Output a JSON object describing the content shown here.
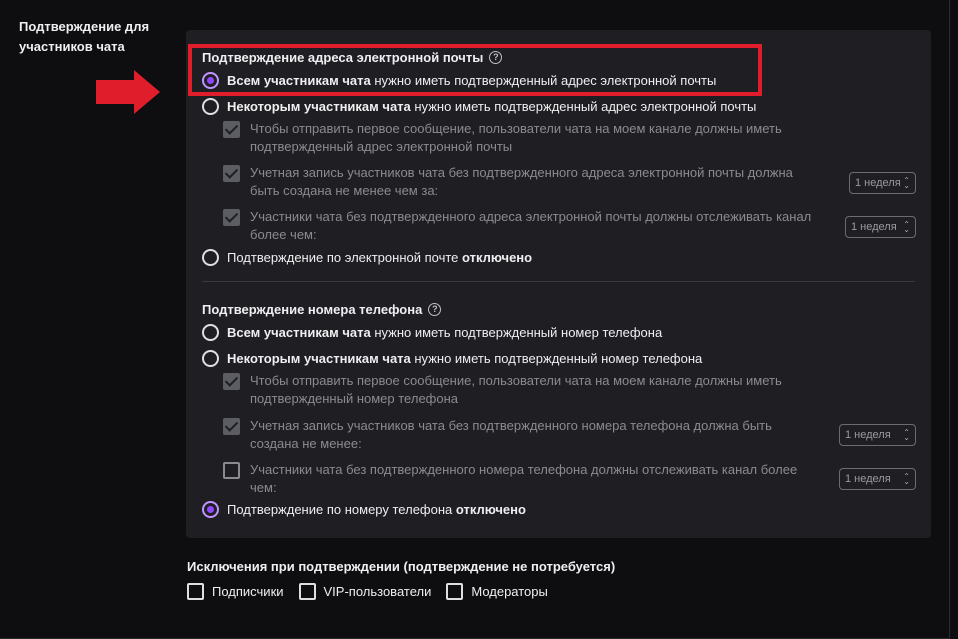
{
  "section": {
    "label": "Подтверждение для участников чата"
  },
  "email": {
    "title": "Подтверждение адреса электронной почты",
    "options": [
      {
        "bold": "Всем участникам чата",
        "rest": " нужно иметь подтвержденный адрес электронной почты",
        "checked": true
      },
      {
        "bold": "Некоторым участникам чата",
        "rest": " нужно иметь подтвержденный адрес электронной почты",
        "checked": false
      }
    ],
    "sub": [
      {
        "text": "Чтобы отправить первое сообщение, пользователи чата на моем канале должны иметь подтвержденный адрес электронной почты",
        "checked": true
      },
      {
        "text": "Учетная запись участников чата без подтвержденного адреса электронной почты должна быть создана не менее чем за:",
        "checked": true,
        "select": "1 неделя"
      },
      {
        "text": "Участники чата без подтвержденного адреса электронной почты должны отслеживать канал более чем:",
        "checked": true,
        "select": "1 неделя"
      }
    ],
    "disabled": {
      "text": "Подтверждение по электронной почте ",
      "bold": "отключено",
      "checked": false
    }
  },
  "phone": {
    "title": "Подтверждение номера телефона",
    "options": [
      {
        "bold": "Всем участникам чата",
        "rest": " нужно иметь подтвержденный номер телефона",
        "checked": false
      },
      {
        "bold": "Некоторым участникам чата",
        "rest": " нужно иметь подтвержденный номер телефона",
        "checked": false
      }
    ],
    "sub": [
      {
        "text": "Чтобы отправить первое сообщение, пользователи чата на моем канале должны иметь подтвержденный номер телефона",
        "checked": true
      },
      {
        "text": "Учетная запись участников чата без подтвержденного номера телефона должна быть создана не менее:",
        "checked": true,
        "select": "1 неделя"
      },
      {
        "text": "Участники чата без подтвержденного номера телефона должны отслеживать канал более чем:",
        "checked": false,
        "select": "1 неделя"
      }
    ],
    "disabled": {
      "text": "Подтверждение по номеру телефона ",
      "bold": "отключено",
      "checked": true
    }
  },
  "exceptions": {
    "title": "Исключения при подтверждении (подтверждение не потребуется)",
    "items": [
      "Подписчики",
      "VIP-пользователи",
      "Модераторы"
    ]
  },
  "colors": {
    "accent": "#9147ff",
    "highlight": "#e01e2b",
    "panel": "#1f1f23",
    "background": "#0e0e10"
  }
}
